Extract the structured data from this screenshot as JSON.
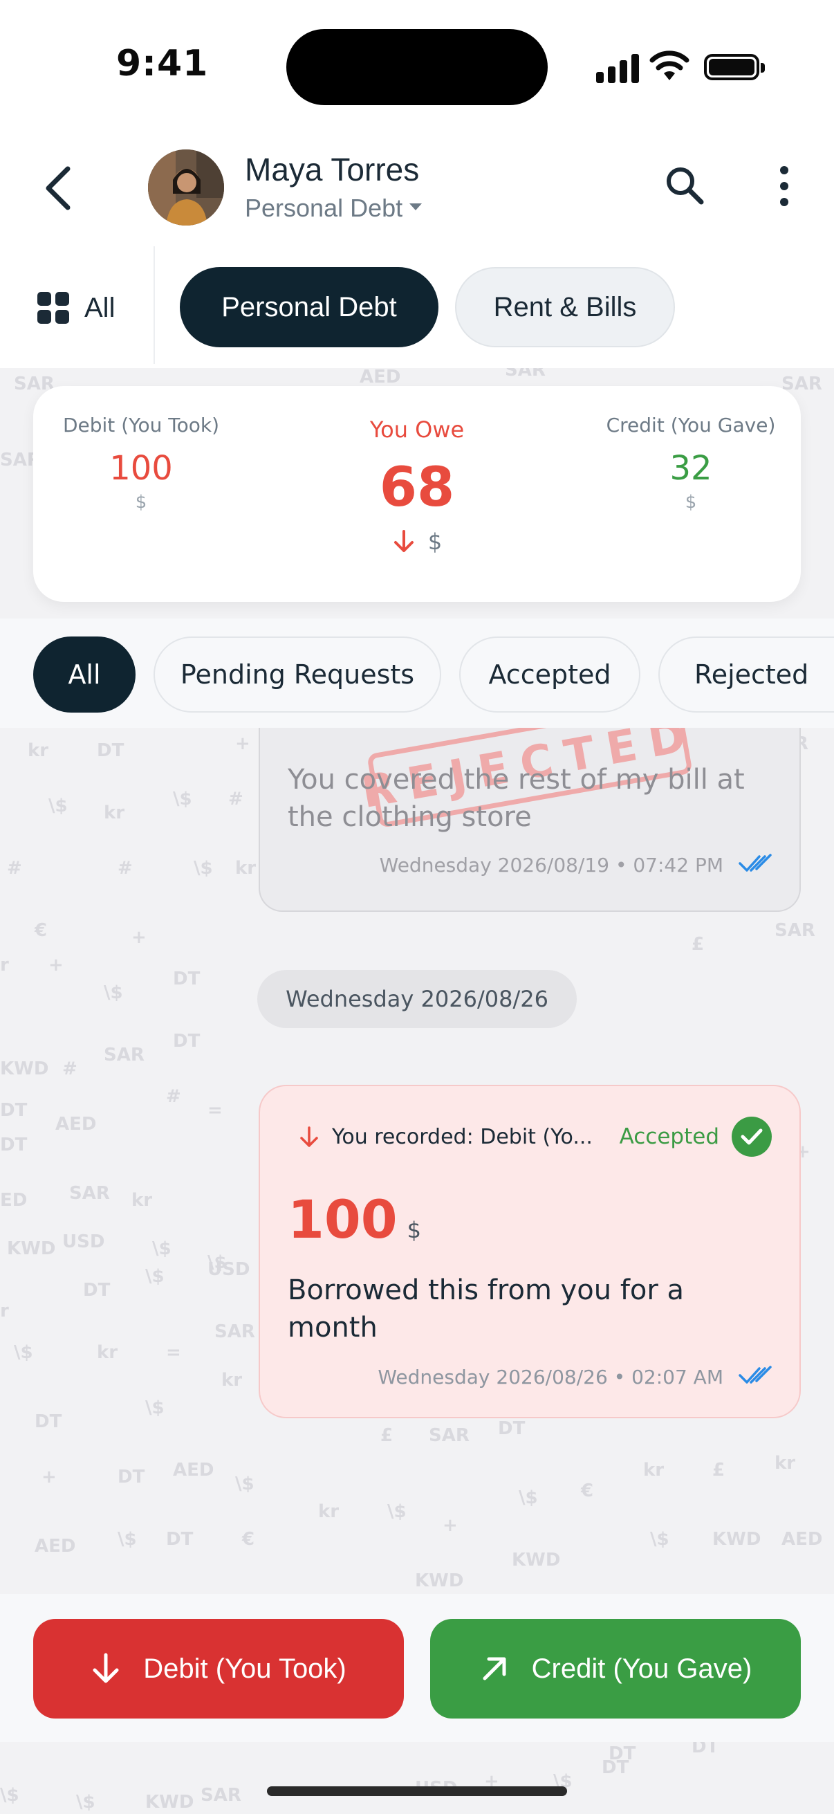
{
  "status_bar": {
    "time": "9:41"
  },
  "header": {
    "contact_name": "Maya Torres",
    "ledger_name": "Personal Debt"
  },
  "category_tabs": {
    "all_label": "All",
    "tabs": [
      "Personal Debt",
      "Rent & Bills"
    ],
    "active": "Personal Debt"
  },
  "summary": {
    "debit_label": "Debit (You Took)",
    "debit_value": "100",
    "debit_currency": "$",
    "balance_label": "You Owe",
    "balance_value": "68",
    "balance_currency": "$",
    "credit_label": "Credit (You Gave)",
    "credit_value": "32",
    "credit_currency": "$"
  },
  "filters": {
    "items": [
      "All",
      "Pending Requests",
      "Accepted",
      "Rejected"
    ],
    "active": "All"
  },
  "messages": [
    {
      "status": "rejected",
      "stamp": "REJECTED",
      "note": "You covered the rest of my bill at the clothing store",
      "timestamp": "Wednesday 2026/08/19 • 07:42 PM"
    },
    {
      "status": "accepted",
      "header": "You recorded: Debit (Yo...",
      "status_label": "Accepted",
      "amount": "100",
      "currency": "$",
      "note": "Borrowed this from you for a month",
      "timestamp": "Wednesday 2026/08/26 • 02:07 AM"
    }
  ],
  "date_separator": "Wednesday 2026/08/26",
  "actions": {
    "debit_label": "Debit (You Took)",
    "credit_label": "Credit (You Gave)"
  },
  "colors": {
    "dark": "#0f2430",
    "debit_red": "#e84b3e",
    "credit_green": "#3a9d44",
    "tick_blue": "#2a8be6"
  }
}
